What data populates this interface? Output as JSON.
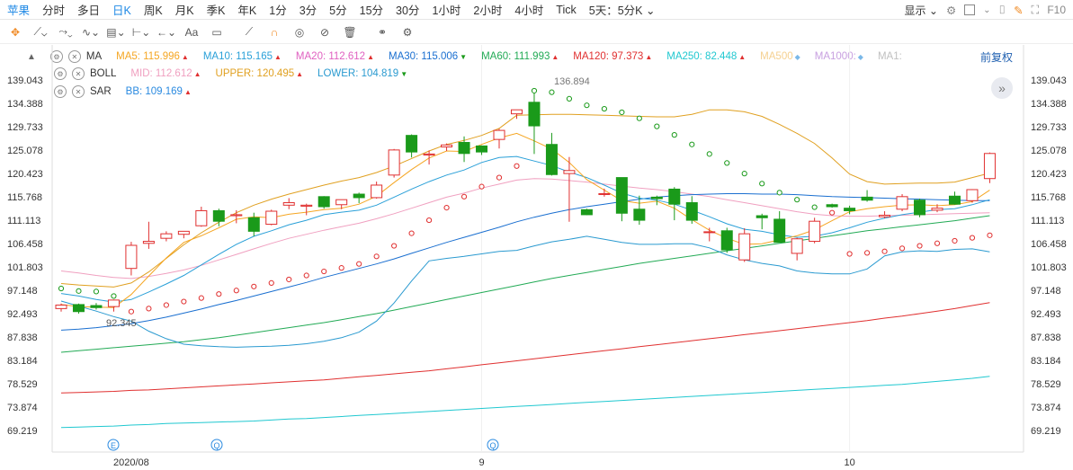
{
  "symbol": "苹果",
  "tabs": [
    "分时",
    "多日",
    "日K",
    "周K",
    "月K",
    "季K",
    "年K",
    "1分",
    "3分",
    "5分",
    "15分",
    "30分",
    "1小时",
    "2小时",
    "4小时",
    "Tick",
    "5天：5分K"
  ],
  "active_tab": "日K",
  "display_label": "显示",
  "fq_label": "前复权",
  "f10_label": "F10",
  "indicators": {
    "ma": {
      "name": "MA",
      "items": [
        {
          "label": "MA5: 115.996",
          "color": "#f5a623",
          "dir": "up"
        },
        {
          "label": "MA10: 115.165",
          "color": "#2aa0d8",
          "dir": "up"
        },
        {
          "label": "MA20: 112.612",
          "color": "#e060c0",
          "dir": "up"
        },
        {
          "label": "MA30: 115.006",
          "color": "#1a6fd0",
          "dir": "down"
        },
        {
          "label": "MA60: 111.993",
          "color": "#22aa55",
          "dir": "up"
        },
        {
          "label": "MA120: 97.373",
          "color": "#e03030",
          "dir": "up"
        },
        {
          "label": "MA250: 82.448",
          "color": "#20c8d0",
          "dir": "up"
        },
        {
          "label": "MA500",
          "color": "#f5d090",
          "dir": "dot"
        },
        {
          "label": "MA1000:",
          "color": "#c8a0e0",
          "dir": "dot"
        },
        {
          "label": "MA1:",
          "color": "#c0c0c0",
          "dir": ""
        }
      ]
    },
    "boll": {
      "name": "BOLL",
      "items": [
        {
          "label": "MID: 112.612",
          "color": "#f0a0c0",
          "dir": "up"
        },
        {
          "label": "UPPER: 120.495",
          "color": "#e0a020",
          "dir": "up"
        },
        {
          "label": "LOWER: 104.819",
          "color": "#2a9ad0",
          "dir": "down"
        }
      ]
    },
    "sar": {
      "name": "SAR",
      "items": [
        {
          "label": "BB: 109.169",
          "color": "#2a8ae0",
          "dir": "up"
        }
      ]
    }
  },
  "chart_data": {
    "type": "candlestick",
    "y_ticks": [
      "139.043",
      "134.388",
      "129.733",
      "125.078",
      "120.423",
      "115.768",
      "111.113",
      "106.458",
      "101.803",
      "97.148",
      "92.493",
      "87.838",
      "83.184",
      "78.529",
      "73.874",
      "69.219"
    ],
    "y_range": [
      69.219,
      139.043
    ],
    "x_labels": [
      {
        "text": "2020/08",
        "index": 4
      },
      {
        "text": "9",
        "index": 24
      },
      {
        "text": "10",
        "index": 45
      }
    ],
    "annotations": {
      "high": "136.894",
      "low": "92.345"
    },
    "candles": [
      {
        "o": 93.5,
        "h": 94.5,
        "c": 94.2,
        "l": 92.9
      },
      {
        "o": 94.3,
        "h": 94.5,
        "c": 92.9,
        "l": 92.5
      },
      {
        "o": 94.1,
        "h": 94.6,
        "c": 93.7,
        "l": 93.3
      },
      {
        "o": 93.9,
        "h": 95.3,
        "c": 95.2,
        "l": 92.9
      },
      {
        "o": 101.5,
        "h": 106.8,
        "c": 106.1,
        "l": 100.1
      },
      {
        "o": 106.5,
        "h": 110.8,
        "c": 106.9,
        "l": 105.4
      },
      {
        "o": 107.5,
        "h": 108.9,
        "c": 108.4,
        "l": 106.9
      },
      {
        "o": 108.3,
        "h": 108.9,
        "c": 108.9,
        "l": 107.5
      },
      {
        "o": 110.0,
        "h": 113.8,
        "c": 113.0,
        "l": 109.8
      },
      {
        "o": 113.0,
        "h": 113.4,
        "c": 110.9,
        "l": 109.9
      },
      {
        "o": 112.0,
        "h": 113.1,
        "c": 112.2,
        "l": 110.5
      },
      {
        "o": 111.6,
        "h": 112.6,
        "c": 108.9,
        "l": 107.9
      },
      {
        "o": 110.3,
        "h": 113.2,
        "c": 112.9,
        "l": 110.1
      },
      {
        "o": 114.1,
        "h": 115.5,
        "c": 114.6,
        "l": 113.3
      },
      {
        "o": 113.9,
        "h": 114.4,
        "c": 114.1,
        "l": 112.1
      },
      {
        "o": 115.8,
        "h": 115.9,
        "c": 113.8,
        "l": 113.4
      },
      {
        "o": 114.2,
        "h": 115.1,
        "c": 115.2,
        "l": 113.3
      },
      {
        "o": 116.3,
        "h": 116.6,
        "c": 115.6,
        "l": 114.5
      },
      {
        "o": 115.6,
        "h": 118.8,
        "c": 118.1,
        "l": 115.4
      },
      {
        "o": 120.1,
        "h": 125.3,
        "c": 125.1,
        "l": 119.6
      },
      {
        "o": 128.0,
        "h": 128.2,
        "c": 124.7,
        "l": 123.6
      },
      {
        "o": 124.1,
        "h": 125.0,
        "c": 124.3,
        "l": 122.2
      },
      {
        "o": 125.7,
        "h": 126.4,
        "c": 126.1,
        "l": 124.9
      },
      {
        "o": 126.6,
        "h": 127.8,
        "c": 124.4,
        "l": 122.7
      },
      {
        "o": 125.9,
        "h": 126.0,
        "c": 124.7,
        "l": 124.1
      },
      {
        "o": 127.2,
        "h": 129.3,
        "c": 129.0,
        "l": 125.4
      },
      {
        "o": 132.3,
        "h": 133.1,
        "c": 133.1,
        "l": 131.3
      },
      {
        "o": 134.6,
        "h": 137.3,
        "c": 129.9,
        "l": 124.3
      },
      {
        "o": 126.2,
        "h": 128.5,
        "c": 120.2,
        "l": 120.0
      },
      {
        "o": 120.4,
        "h": 123.7,
        "c": 121.0,
        "l": 110.8
      },
      {
        "o": 113.2,
        "h": 113.4,
        "c": 112.2,
        "l": 112.1
      },
      {
        "o": 116.3,
        "h": 117.4,
        "c": 116.4,
        "l": 115.8
      },
      {
        "o": 119.6,
        "h": 119.6,
        "c": 112.5,
        "l": 110.9
      },
      {
        "o": 113.3,
        "h": 116.0,
        "c": 111.1,
        "l": 110.2
      },
      {
        "o": 115.7,
        "h": 116.0,
        "c": 115.4,
        "l": 114.1
      },
      {
        "o": 117.3,
        "h": 117.7,
        "c": 114.3,
        "l": 111.1
      },
      {
        "o": 114.6,
        "h": 115.9,
        "c": 111.1,
        "l": 110.4
      },
      {
        "o": 108.7,
        "h": 109.6,
        "c": 108.8,
        "l": 106.9
      },
      {
        "o": 109.0,
        "h": 109.6,
        "c": 105.2,
        "l": 104.6
      },
      {
        "o": 103.2,
        "h": 109.5,
        "c": 108.4,
        "l": 102.8
      },
      {
        "o": 112.0,
        "h": 112.4,
        "c": 111.6,
        "l": 109.3
      },
      {
        "o": 111.3,
        "h": 112.9,
        "c": 106.7,
        "l": 106.7
      },
      {
        "o": 104.5,
        "h": 107.6,
        "c": 107.4,
        "l": 103.1
      },
      {
        "o": 106.9,
        "h": 111.6,
        "c": 110.9,
        "l": 106.5
      },
      {
        "o": 114.2,
        "h": 114.4,
        "c": 113.8,
        "l": 113.6
      },
      {
        "o": 113.5,
        "h": 114.0,
        "c": 113.0,
        "l": 112.3
      },
      {
        "o": 115.7,
        "h": 117.1,
        "c": 115.1,
        "l": 114.8
      },
      {
        "o": 111.8,
        "h": 112.9,
        "c": 112.1,
        "l": 111.5
      },
      {
        "o": 113.3,
        "h": 116.3,
        "c": 115.8,
        "l": 112.9
      },
      {
        "o": 115.1,
        "h": 115.4,
        "c": 112.2,
        "l": 111.7
      },
      {
        "o": 113.1,
        "h": 114.3,
        "c": 113.5,
        "l": 112.7
      },
      {
        "o": 115.9,
        "h": 116.8,
        "c": 114.3,
        "l": 114.2
      },
      {
        "o": 115.0,
        "h": 117.3,
        "c": 117.2,
        "l": 114.6
      },
      {
        "o": 119.4,
        "h": 124.6,
        "c": 124.4,
        "l": 118.5
      }
    ],
    "series": {
      "ma5": [
        94.3,
        93.9,
        93.8,
        93.7,
        96.3,
        100.0,
        103.6,
        106.7,
        108.0,
        109.6,
        111.3,
        111.8,
        111.6,
        112.3,
        112.7,
        113.2,
        113.5,
        114.3,
        115.9,
        118.6,
        121.2,
        123.5,
        124.9,
        124.8,
        126.2,
        127.5,
        128.4,
        126.9,
        125.3,
        122.6,
        119.2,
        117.1,
        115.0,
        114.5,
        114.9,
        113.5,
        111.2,
        109.1,
        107.5,
        106.3,
        106.4,
        107.2,
        108.0,
        109.2,
        111.0,
        112.8,
        113.4,
        113.8,
        114.1,
        114.2,
        114.0,
        114.2,
        114.8,
        117.1
      ],
      "ma10": [
        96.5,
        96.0,
        95.3,
        94.8,
        95.3,
        96.8,
        98.4,
        100.1,
        102.2,
        104.3,
        106.3,
        107.9,
        109.0,
        110.2,
        111.1,
        112.2,
        112.7,
        113.1,
        114.1,
        115.7,
        117.3,
        118.8,
        120.1,
        121.1,
        122.6,
        123.6,
        123.8,
        122.9,
        122.0,
        120.7,
        119.6,
        118.1,
        116.5,
        115.5,
        115.1,
        114.3,
        113.1,
        111.8,
        110.4,
        109.3,
        108.9,
        108.2,
        107.7,
        107.9,
        108.6,
        109.6,
        110.7,
        111.5,
        112.2,
        112.7,
        113.2,
        113.4,
        114.2,
        115.2
      ],
      "mid": [
        101.0,
        100.6,
        100.1,
        99.7,
        99.5,
        99.9,
        100.5,
        101.2,
        102.1,
        103.2,
        104.3,
        105.4,
        106.5,
        107.5,
        108.3,
        109.1,
        109.8,
        110.5,
        111.4,
        112.4,
        113.5,
        114.6,
        115.7,
        116.5,
        117.5,
        118.3,
        119.1,
        119.4,
        119.3,
        119.0,
        118.7,
        118.3,
        117.9,
        117.5,
        117.2,
        116.8,
        116.3,
        115.8,
        115.2,
        114.6,
        114.0,
        113.4,
        112.8,
        112.3,
        112.0,
        111.9,
        111.9,
        112.0,
        112.1,
        112.2,
        112.3,
        112.4,
        112.5,
        112.6
      ],
      "upper": [
        98.5,
        98.2,
        98.0,
        97.8,
        98.6,
        100.8,
        103.5,
        106.2,
        108.6,
        110.7,
        112.6,
        114.1,
        115.3,
        116.3,
        117.2,
        118.1,
        118.9,
        119.6,
        120.6,
        121.9,
        123.4,
        124.9,
        126.2,
        127.0,
        128.0,
        129.4,
        132.0,
        132.1,
        132.2,
        132.2,
        132.1,
        132.0,
        131.9,
        131.8,
        131.7,
        131.7,
        132.2,
        133.1,
        133.1,
        132.7,
        131.8,
        130.2,
        128.4,
        126.4,
        123.5,
        120.3,
        118.8,
        118.3,
        118.4,
        118.5,
        118.5,
        118.7,
        119.6,
        120.5
      ],
      "lower": [
        95.0,
        94.0,
        93.0,
        91.9,
        91.0,
        89.0,
        87.5,
        86.4,
        86.1,
        85.9,
        85.8,
        85.9,
        86.0,
        86.2,
        86.5,
        87.0,
        87.7,
        88.8,
        91.0,
        94.6,
        99.0,
        103.0,
        103.5,
        103.9,
        104.4,
        104.9,
        105.1,
        106.0,
        106.8,
        107.3,
        107.9,
        107.3,
        106.7,
        106.3,
        106.3,
        106.4,
        106.4,
        105.6,
        104.2,
        103.2,
        102.5,
        102.0,
        101.0,
        100.6,
        100.4,
        100.4,
        101.4,
        104.0,
        104.8,
        105.0,
        104.9,
        105.3,
        105.4,
        104.8
      ],
      "ma30": [
        89.2,
        89.4,
        89.7,
        90.1,
        90.5,
        91.1,
        91.8,
        92.6,
        93.4,
        94.3,
        95.1,
        96.0,
        96.9,
        97.8,
        98.7,
        99.7,
        100.6,
        101.5,
        102.4,
        103.4,
        104.5,
        105.6,
        106.7,
        107.7,
        108.7,
        109.7,
        110.8,
        111.7,
        112.5,
        113.2,
        113.8,
        114.3,
        114.8,
        115.3,
        115.7,
        116.0,
        116.2,
        116.3,
        116.4,
        116.4,
        116.3,
        116.3,
        116.2,
        116.0,
        115.8,
        115.7,
        115.6,
        115.5,
        115.4,
        115.3,
        115.2,
        115.1,
        115.0,
        115.0
      ],
      "ma60": [
        84.8,
        85.1,
        85.4,
        85.7,
        86.0,
        86.3,
        86.6,
        86.9,
        87.3,
        87.7,
        88.2,
        88.7,
        89.2,
        89.7,
        90.2,
        90.7,
        91.3,
        91.9,
        92.5,
        93.2,
        93.9,
        94.6,
        95.3,
        96.0,
        96.7,
        97.4,
        98.1,
        98.8,
        99.5,
        100.1,
        100.7,
        101.3,
        101.9,
        102.5,
        103.0,
        103.5,
        104.0,
        104.5,
        105.0,
        105.5,
        106.0,
        106.5,
        107.0,
        107.5,
        108.0,
        108.5,
        109.0,
        109.4,
        109.8,
        110.2,
        110.6,
        111.0,
        111.5,
        112.0
      ],
      "ma120": [
        76.7,
        76.8,
        76.9,
        77.0,
        77.2,
        77.3,
        77.5,
        77.7,
        77.9,
        78.1,
        78.3,
        78.5,
        78.7,
        78.9,
        79.1,
        79.3,
        79.6,
        79.9,
        80.2,
        80.5,
        80.8,
        81.1,
        81.5,
        81.9,
        82.3,
        82.7,
        83.1,
        83.5,
        83.9,
        84.3,
        84.7,
        85.1,
        85.5,
        85.9,
        86.3,
        86.7,
        87.1,
        87.5,
        87.9,
        88.3,
        88.7,
        89.1,
        89.5,
        89.9,
        90.3,
        90.7,
        91.1,
        91.6,
        92.0,
        92.5,
        93.0,
        93.5,
        94.1,
        94.7
      ],
      "ma250": [
        69.8,
        69.9,
        70.0,
        70.1,
        70.3,
        70.4,
        70.6,
        70.7,
        70.8,
        70.9,
        71.0,
        71.1,
        71.3,
        71.5,
        71.6,
        71.8,
        72.0,
        72.2,
        72.4,
        72.6,
        72.8,
        73.0,
        73.2,
        73.4,
        73.6,
        73.8,
        74.0,
        74.2,
        74.4,
        74.6,
        74.8,
        75.0,
        75.2,
        75.4,
        75.6,
        75.8,
        76.0,
        76.2,
        76.4,
        76.6,
        76.8,
        77.0,
        77.2,
        77.4,
        77.6,
        77.8,
        78.0,
        78.2,
        78.4,
        78.7,
        79.0,
        79.3,
        79.6,
        80.0
      ],
      "sar": [
        97.5,
        97.0,
        96.9,
        96.0,
        92.9,
        93.5,
        94.2,
        94.9,
        95.6,
        96.4,
        97.1,
        97.9,
        98.6,
        99.3,
        100.1,
        100.9,
        101.6,
        102.4,
        103.9,
        106.0,
        108.5,
        111.1,
        113.6,
        115.8,
        117.8,
        119.6,
        121.9,
        136.9,
        136.6,
        135.3,
        134.0,
        133.3,
        132.6,
        131.4,
        129.8,
        128.1,
        126.2,
        124.3,
        122.5,
        120.4,
        118.4,
        116.6,
        115.2,
        113.7,
        112.6,
        104.4,
        104.6,
        104.9,
        105.5,
        106.0,
        106.5,
        107.0,
        107.6,
        108.1
      ]
    }
  }
}
